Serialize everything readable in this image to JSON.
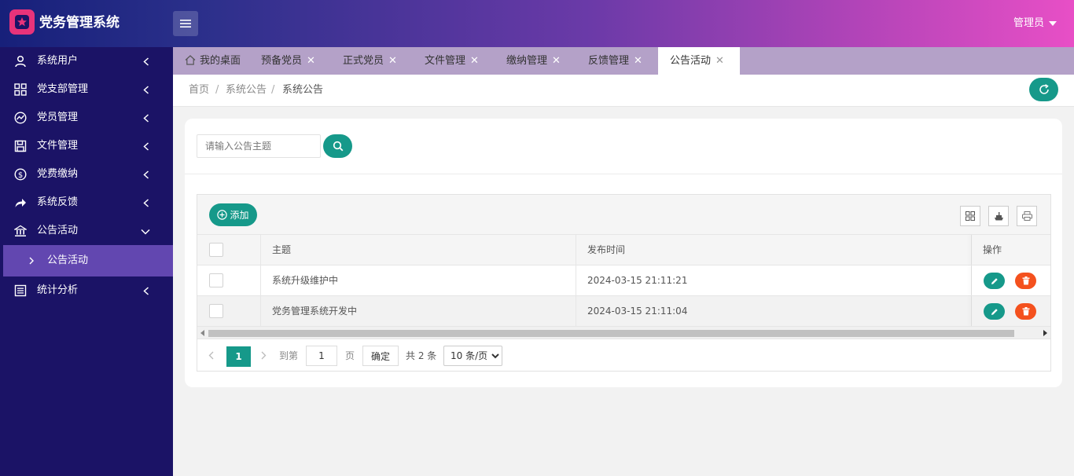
{
  "header": {
    "brand": "党务管理系统",
    "user": "管理员"
  },
  "sidebar": {
    "items": [
      {
        "label": "系统用户",
        "icon": "user-icon"
      },
      {
        "label": "党支部管理",
        "icon": "grid-icon"
      },
      {
        "label": "党员管理",
        "icon": "chart-icon"
      },
      {
        "label": "文件管理",
        "icon": "save-icon"
      },
      {
        "label": "党费缴纳",
        "icon": "dollar-icon"
      },
      {
        "label": "系统反馈",
        "icon": "share-icon"
      },
      {
        "label": "公告活动",
        "icon": "bank-icon"
      },
      {
        "label": "统计分析",
        "icon": "list-icon"
      }
    ],
    "sub_item": "公告活动"
  },
  "tabs": [
    {
      "label": "我的桌面"
    },
    {
      "label": "预备党员"
    },
    {
      "label": "正式党员"
    },
    {
      "label": "文件管理"
    },
    {
      "label": "缴纳管理"
    },
    {
      "label": "反馈管理"
    },
    {
      "label": "公告活动"
    }
  ],
  "breadcrumb": [
    "首页",
    "系统公告",
    "系统公告"
  ],
  "search": {
    "placeholder": "请输入公告主题",
    "value": ""
  },
  "toolbar": {
    "add_label": "添加"
  },
  "table": {
    "columns": [
      "主题",
      "发布时间",
      "操作"
    ],
    "rows": [
      {
        "title": "系统升级维护中",
        "time": "2024-03-15 21:11:21"
      },
      {
        "title": "党务管理系统开发中",
        "time": "2024-03-15 21:11:04"
      }
    ]
  },
  "pager": {
    "current": "1",
    "goto_label": "到第",
    "page_label": "页",
    "input_value": "1",
    "confirm_label": "确定",
    "total_label": "共 2 条",
    "page_size": "10 条/页"
  },
  "colors": {
    "accent": "#16998a",
    "danger": "#f4511e",
    "sidebar": "#1b1366",
    "sidebar_active": "#6247b0"
  }
}
